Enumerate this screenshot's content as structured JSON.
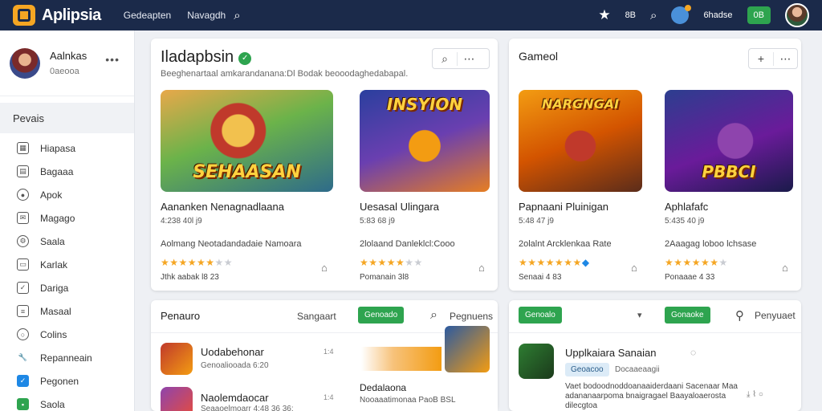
{
  "topbar": {
    "app_name": "Aplipsia",
    "nav": [
      "Gedeapten",
      "Navagdh"
    ],
    "count": "8B",
    "status": "6hadse",
    "button": "0B"
  },
  "sidebar": {
    "profile_name": "Aalnkas",
    "profile_sub": "0aeooa",
    "section": "Pevais",
    "items": [
      {
        "label": "Hiapasa",
        "icon": "calendar-icon"
      },
      {
        "label": "Bagaaa",
        "icon": "bag-icon"
      },
      {
        "label": "Apok",
        "icon": "user-icon"
      },
      {
        "label": "Magago",
        "icon": "mail-icon"
      },
      {
        "label": "Saala",
        "icon": "settings-icon"
      },
      {
        "label": "Karlak",
        "icon": "bookmark-icon"
      },
      {
        "label": "Dariga",
        "icon": "check-icon"
      },
      {
        "label": "Masaal",
        "icon": "list-icon"
      },
      {
        "label": "Colins",
        "icon": "coin-icon"
      },
      {
        "label": "Repanneain",
        "icon": "wrench-icon"
      },
      {
        "label": "Pegonen",
        "icon": "checkbox-icon"
      },
      {
        "label": "Saola",
        "icon": "shield-icon"
      }
    ]
  },
  "featured": {
    "title": "Iladapbsin",
    "subtitle": "Beeghenartaal amkarandanana:Dl Bodak beooodaghedabapal.",
    "cards": [
      {
        "art": "SEHAASAN",
        "title": "Aananken Nenagnadlaana",
        "meta": "4:238 40l j9",
        "desc": "Aolmang Neotadandadaie Namoara",
        "stars": "★★★★★★",
        "off": "★★",
        "foot": "Jthk aabak l8 23"
      },
      {
        "art": "INSYION",
        "title": "Uesasal Ulingara",
        "meta": "5:83 68 j9",
        "desc": "2lolaand Danleklcl:Cooo",
        "stars": "★★★★★",
        "off": "★★",
        "foot": "Pomanain 3l8"
      },
      {
        "art": "NARGNGAI",
        "title": "Papnaani Pluinigan",
        "meta": "5:48 47 j9",
        "desc": "2olalnt Arcklenkaa Rate",
        "stars": "★★★★★★★",
        "off": "◆",
        "foot": "Senaai 4 83"
      }
    ]
  },
  "side_panel": {
    "title": "Gameol",
    "card": {
      "art": "PBBCI",
      "title": "Aphlafafc",
      "meta": "5:435 40 j9",
      "desc": "2Aaagag loboo lchsase",
      "stars": "★★★★★★",
      "off": "★",
      "foot": "Ponaaae 4 33"
    }
  },
  "popular": {
    "title": "Penauro",
    "sort": "Sangaart",
    "pill": "Genoado",
    "search_label": "Pegnuens",
    "items": [
      {
        "title": "Uodabehonar",
        "sub": "Genoaliooada 6:20",
        "time": "1:4"
      },
      {
        "title": "Naolemdaocar",
        "sub": "Seaaoelmoarr 4:48  36 36:",
        "time": "1:4"
      }
    ],
    "promo_title": "Dedalaona",
    "promo_sub": "Nooaaatimonaa PaoB BSL"
  },
  "updates": {
    "pill_left": "Genoalo",
    "pill_right": "Gonaoke",
    "action": "Penyuaet",
    "item_title": "Upplkaiara Sanaian",
    "chip": "Geoacoo",
    "item_tag": "Docaaeaagii",
    "desc": "Vaet bodoodnoddoanaaiderdaani Sacenaar Maa adananaarpoma bnaigragael Baayaloaerosta dilecgtoa"
  }
}
